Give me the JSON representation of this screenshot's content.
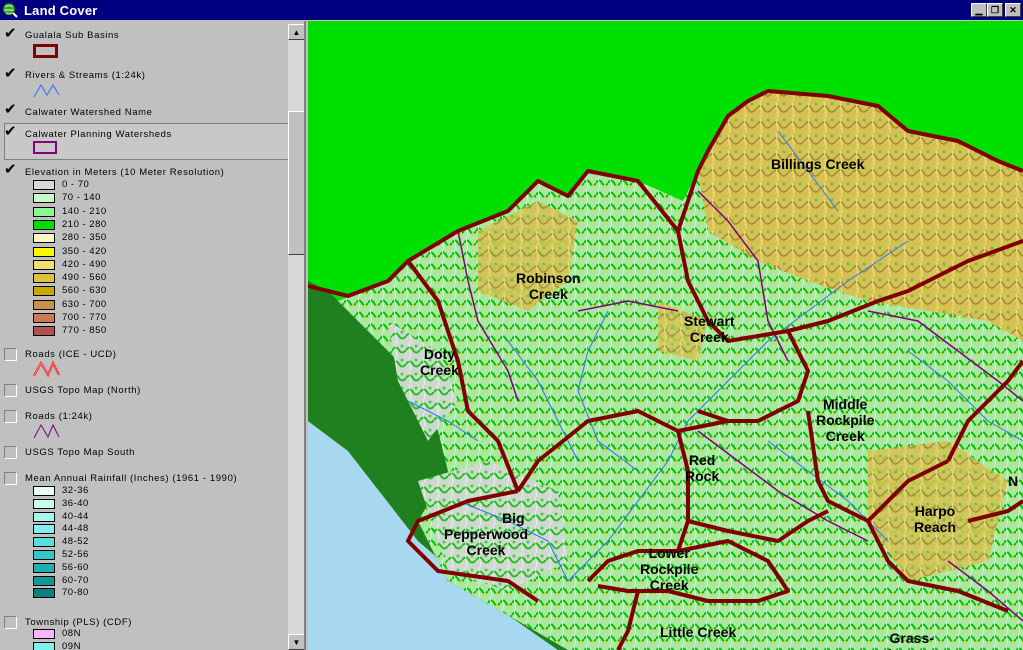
{
  "window": {
    "title": "Land Cover"
  },
  "toc": {
    "layers": [
      {
        "name": "Gualala Sub Basins",
        "checked": true
      },
      {
        "name": "Rivers & Streams (1:24k)",
        "checked": true
      },
      {
        "name": "Calwater Watershed Name",
        "checked": true
      },
      {
        "name": "Calwater Planning Watersheds",
        "checked": true
      },
      {
        "name": "Elevation in Meters (10 Meter Resolution)",
        "checked": true
      },
      {
        "name": "Roads (ICE - UCD)",
        "checked": false
      },
      {
        "name": "USGS Topo Map (North)",
        "checked": false
      },
      {
        "name": "Roads (1:24k)",
        "checked": false
      },
      {
        "name": "USGS Topo Map South",
        "checked": false
      },
      {
        "name": "Mean Annual Rainfall (Inches) (1961 - 1990)",
        "checked": false
      },
      {
        "name": "Township (PLS) (CDF)",
        "checked": false
      }
    ],
    "elevation_classes": [
      {
        "label": "0 - 70",
        "color": "#d8d8d8"
      },
      {
        "label": "70 - 140",
        "color": "#c8f8c8"
      },
      {
        "label": "140 - 210",
        "color": "#90f890"
      },
      {
        "label": "210 - 280",
        "color": "#00e000"
      },
      {
        "label": "280 - 350",
        "color": "#f8f8c0"
      },
      {
        "label": "350 - 420",
        "color": "#f8f800"
      },
      {
        "label": "420 - 490",
        "color": "#f0e070"
      },
      {
        "label": "490 - 560",
        "color": "#e0c040"
      },
      {
        "label": "560 - 630",
        "color": "#c8a800"
      },
      {
        "label": "630 - 700",
        "color": "#c89048"
      },
      {
        "label": "700 - 770",
        "color": "#d07850"
      },
      {
        "label": "770 - 850",
        "color": "#b05050"
      }
    ],
    "rainfall_classes": [
      {
        "label": "32-36",
        "color": "#e8fff8"
      },
      {
        "label": "36-40",
        "color": "#c8fff0"
      },
      {
        "label": "40-44",
        "color": "#a8f8f0"
      },
      {
        "label": "44-48",
        "color": "#80f0f0"
      },
      {
        "label": "48-52",
        "color": "#50e0e0"
      },
      {
        "label": "52-56",
        "color": "#30c8c8"
      },
      {
        "label": "56-60",
        "color": "#20b0b0"
      },
      {
        "label": "60-70",
        "color": "#109898"
      },
      {
        "label": "70-80",
        "color": "#088080"
      }
    ],
    "township_classes": [
      {
        "label": "08N",
        "color": "#f8b8f8"
      },
      {
        "label": "09N",
        "color": "#80f0f0"
      }
    ]
  },
  "map": {
    "labels": [
      "Billings Creek",
      "Robinson\nCreek",
      "Stewart\nCreek",
      "Doty\nCreek",
      "Middle\nRockpile\nCreek",
      "Red\nRock",
      "Big",
      "Pepperwood\nCreek",
      "Harpo\nReach",
      "Lower\nRockpile\nCreek",
      "Little Creek",
      "Grass-\nhopper",
      "N"
    ]
  }
}
